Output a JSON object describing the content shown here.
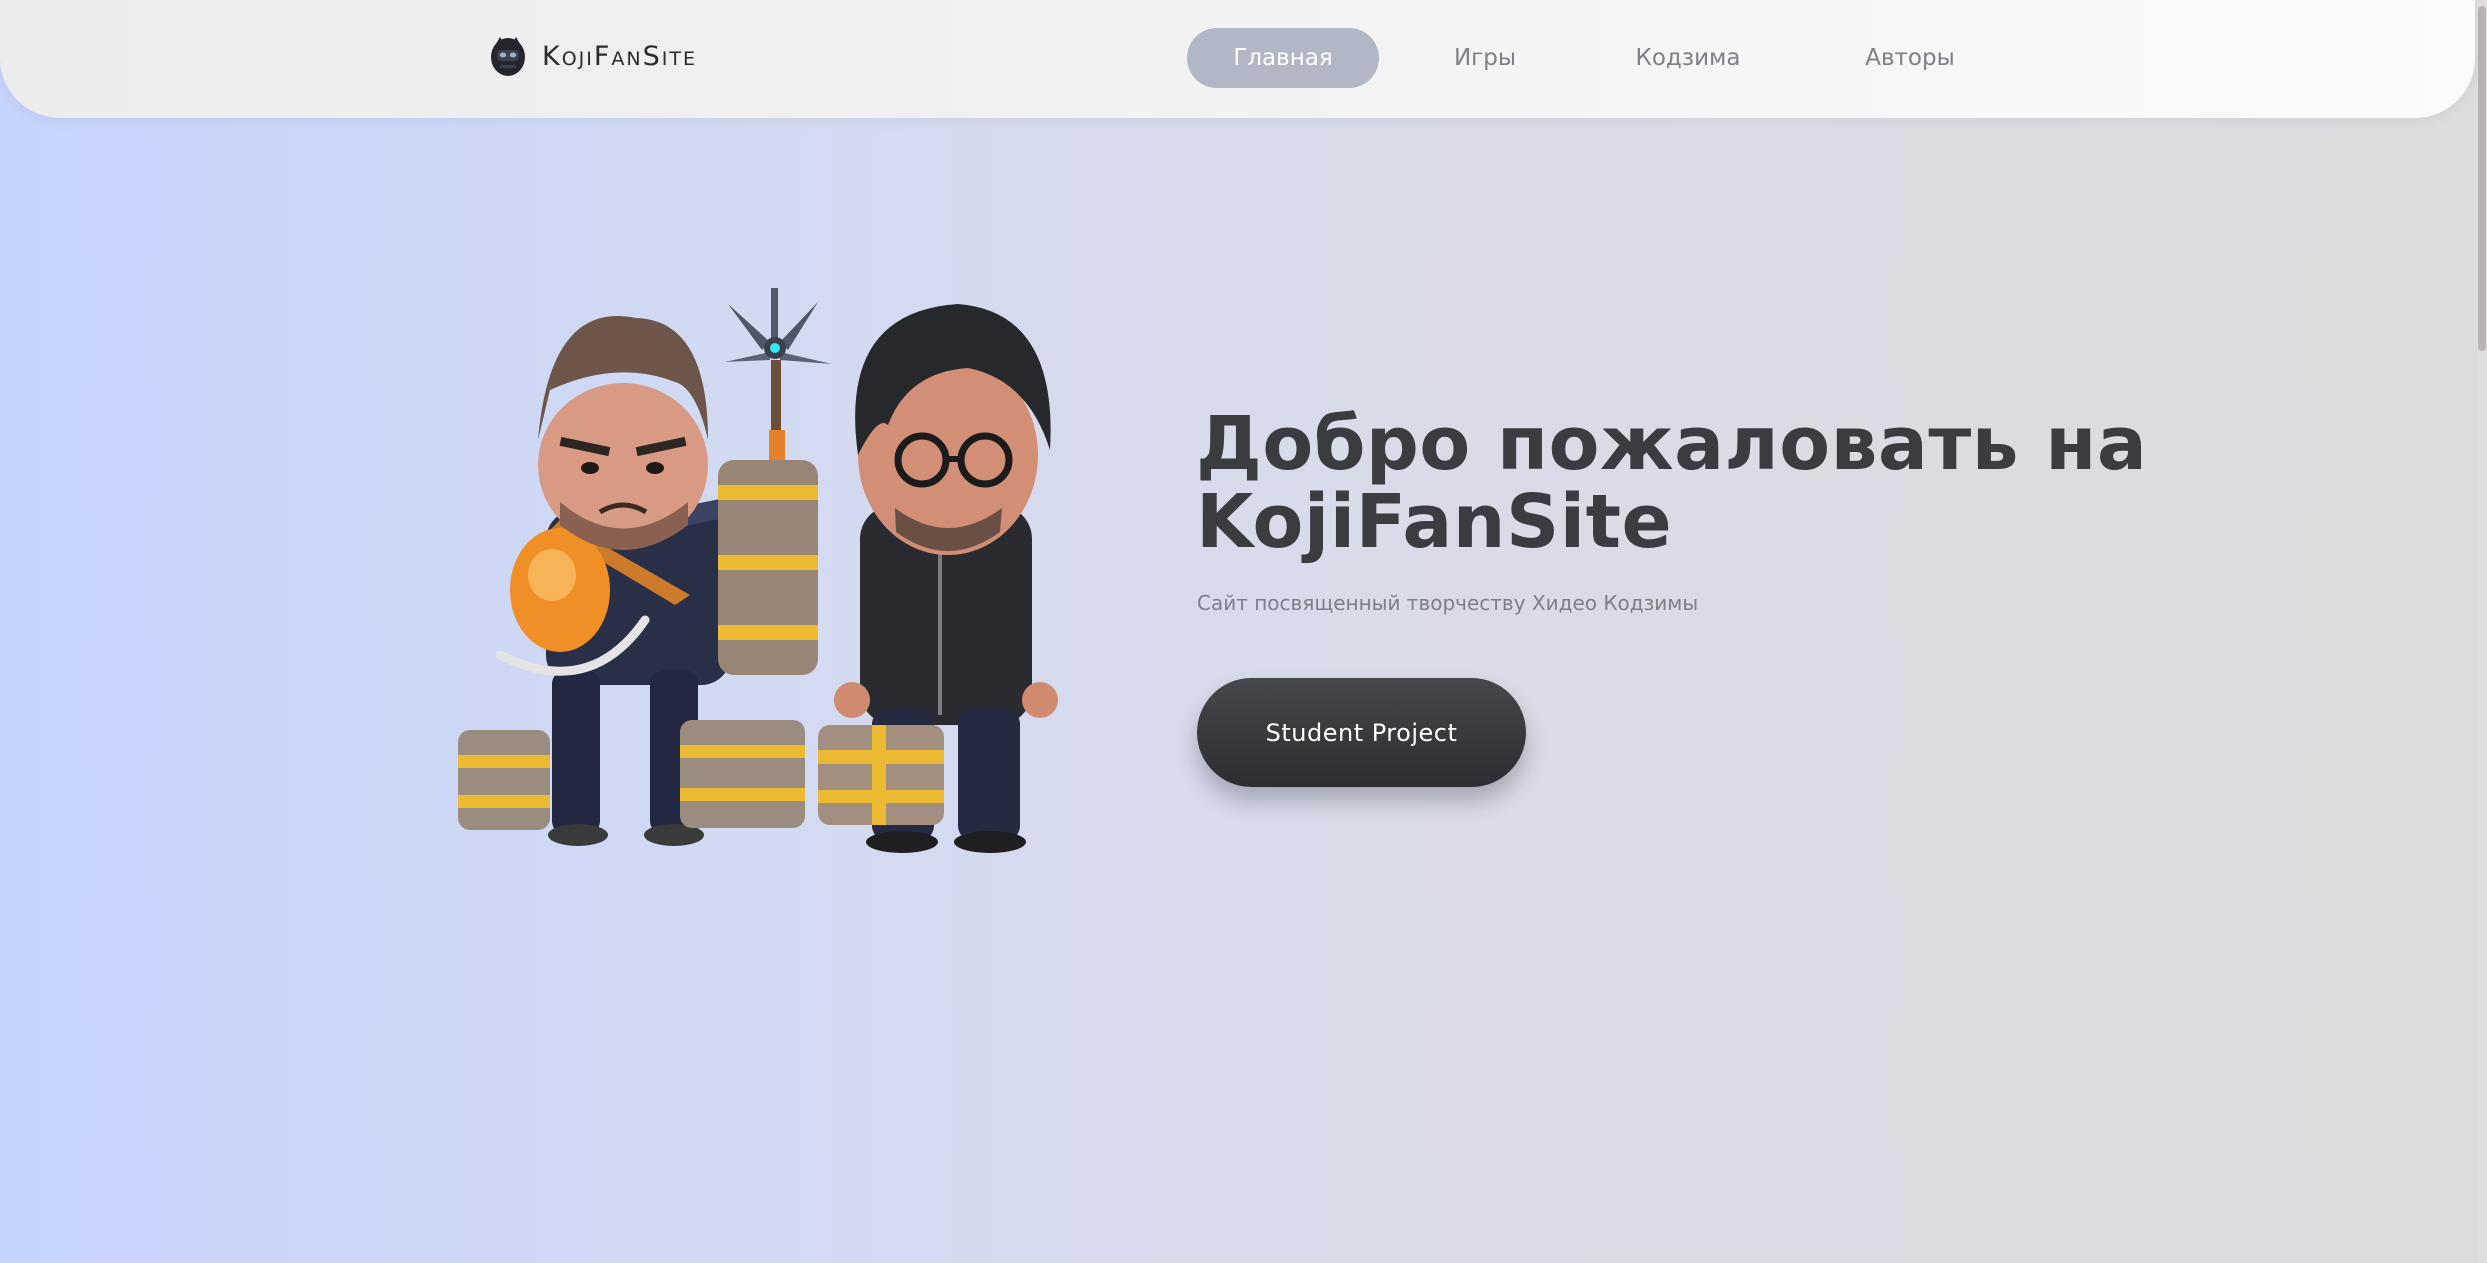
{
  "header": {
    "logo_text": "KojiFanSite",
    "nav": [
      {
        "label": "Главная",
        "active": true
      },
      {
        "label": "Игры",
        "active": false
      },
      {
        "label": "Кодзима",
        "active": false
      },
      {
        "label": "Авторы",
        "active": false
      }
    ]
  },
  "hero": {
    "title_line1": "Добро пожаловать на",
    "title_line2": "KojiFanSite",
    "subtitle": "Сайт посвященный творчеству Хидео Кодзимы",
    "cta_label": "Student Project",
    "image_subject": "chibi figures of a courier with cargo and a man in glasses"
  },
  "colors": {
    "accent_active_tab": "#b2b7c6",
    "title_text": "#3b3c40",
    "button_bg": "#38393c",
    "background_left": "#c6d3fd",
    "background_right": "#dcdcde"
  },
  "icons": [
    "masked-head-logo-icon"
  ]
}
